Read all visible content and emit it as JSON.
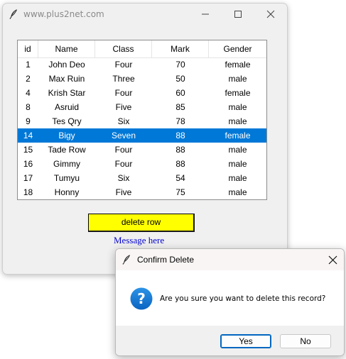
{
  "main_window": {
    "title": "www.plus2net.com",
    "controls": {
      "minimize": "minimize-icon",
      "maximize": "maximize-icon",
      "close": "close-icon"
    }
  },
  "table": {
    "columns": [
      "id",
      "Name",
      "Class",
      "Mark",
      "Gender"
    ],
    "rows": [
      [
        "1",
        "John Deo",
        "Four",
        "70",
        "female"
      ],
      [
        "2",
        "Max Ruin",
        "Three",
        "50",
        "male"
      ],
      [
        "4",
        "Krish Star",
        "Four",
        "60",
        "female"
      ],
      [
        "8",
        "Asruid",
        "Five",
        "85",
        "male"
      ],
      [
        "9",
        "Tes Qry",
        "Six",
        "78",
        "male"
      ],
      [
        "14",
        "Bigy",
        "Seven",
        "88",
        "female"
      ],
      [
        "15",
        "Tade Row",
        "Four",
        "88",
        "male"
      ],
      [
        "16",
        "Gimmy",
        "Four",
        "88",
        "male"
      ],
      [
        "17",
        "Tumyu",
        "Six",
        "54",
        "male"
      ],
      [
        "18",
        "Honny",
        "Five",
        "75",
        "male"
      ]
    ],
    "selected_row_index": 5,
    "selection_color": "#0078d7"
  },
  "delete_button": {
    "label": "delete row",
    "color": "#ffff00"
  },
  "message": {
    "text": "Message here",
    "color": "#0000cc"
  },
  "dialog": {
    "title": "Confirm Delete",
    "icon": "question-icon",
    "message": "Are you sure you want to delete this record?",
    "yes_label": "Yes",
    "no_label": "No"
  }
}
